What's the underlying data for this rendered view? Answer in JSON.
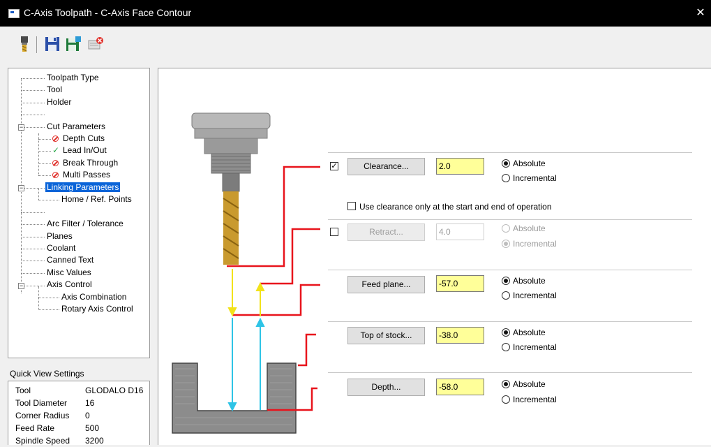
{
  "window": {
    "title": "C-Axis Toolpath - C-Axis Face Contour",
    "close_glyph": "✕"
  },
  "toolbar": {
    "icons": [
      "tool-icon",
      "save-icon",
      "save-as-icon",
      "cancel-icon"
    ]
  },
  "tree": {
    "items": [
      {
        "label": "Toolpath Type"
      },
      {
        "label": "Tool"
      },
      {
        "label": "Holder"
      },
      {
        "label": ""
      },
      {
        "label": "Cut Parameters",
        "expander": "−"
      },
      {
        "label": "Depth Cuts",
        "status": "disabled"
      },
      {
        "label": "Lead In/Out",
        "status": "ok"
      },
      {
        "label": "Break Through",
        "status": "disabled"
      },
      {
        "label": "Multi Passes",
        "status": "disabled"
      },
      {
        "label": "Linking Parameters",
        "expander": "−",
        "selected": true
      },
      {
        "label": "Home / Ref. Points"
      },
      {
        "label": ""
      },
      {
        "label": "Arc Filter / Tolerance"
      },
      {
        "label": "Planes"
      },
      {
        "label": "Coolant"
      },
      {
        "label": "Canned Text"
      },
      {
        "label": "Misc Values"
      },
      {
        "label": "Axis Control",
        "expander": "−"
      },
      {
        "label": "Axis Combination"
      },
      {
        "label": "Rotary Axis Control"
      }
    ]
  },
  "quick_view": {
    "title": "Quick View Settings",
    "rows": [
      {
        "key": "Tool",
        "value": "GLODALO D16"
      },
      {
        "key": "Tool Diameter",
        "value": "16"
      },
      {
        "key": "Corner Radius",
        "value": "0"
      },
      {
        "key": "Feed Rate",
        "value": "500"
      },
      {
        "key": "Spindle Speed",
        "value": "3200"
      }
    ]
  },
  "linking": {
    "clearance": {
      "checked": true,
      "check_glyph": "✓",
      "button": "Clearance...",
      "value": "2.0",
      "absolute": "Absolute",
      "incremental": "Incremental",
      "mode": "absolute"
    },
    "clearance_only": {
      "checked": false,
      "label": "Use clearance only at the start and end of operation"
    },
    "retract": {
      "checked": false,
      "button": "Retract...",
      "value": "4.0",
      "absolute": "Absolute",
      "incremental": "Incremental",
      "mode": "incremental",
      "disabled": true
    },
    "feed_plane": {
      "button": "Feed plane...",
      "value": "-57.0",
      "absolute": "Absolute",
      "incremental": "Incremental",
      "mode": "absolute"
    },
    "top_of_stock": {
      "button": "Top of stock...",
      "value": "-38.0",
      "absolute": "Absolute",
      "incremental": "Incremental",
      "mode": "absolute"
    },
    "depth": {
      "button": "Depth...",
      "value": "-58.0",
      "absolute": "Absolute",
      "incremental": "Incremental",
      "mode": "absolute"
    }
  },
  "colors": {
    "selection": "#0a64d8",
    "field_highlight": "#ffff99",
    "diagram_red": "#e8141c",
    "diagram_yellow": "#f2e21a",
    "diagram_cyan": "#2ec4e6",
    "tool_gold": "#c99a2e",
    "stock_gray": "#8c8c8c"
  }
}
